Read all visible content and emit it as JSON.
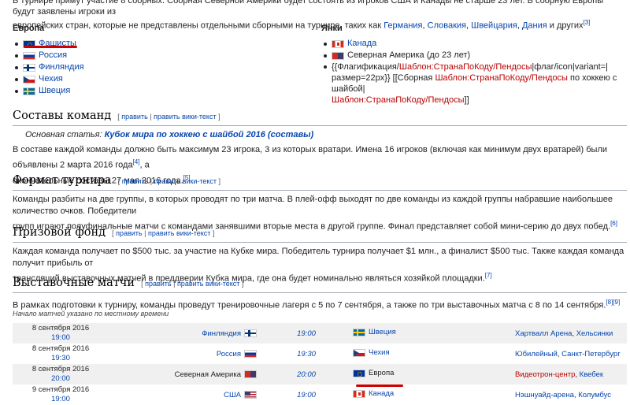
{
  "intro": {
    "line1": "В турнире примут участие 8 сборных. Сборная Северной Америки будет состоять из игроков США и Канады не старше 23 лет. В сборную Европы будут заявлены игроки из",
    "line2_prefix": "европейских стран, которые не представлены отдельными сборными на турнире, таких как ",
    "line2_links": [
      "Германия",
      "Словакия",
      "Швейцария",
      "Дания"
    ],
    "line2_suffix": " и других",
    "ref": "[3]"
  },
  "groups": [
    {
      "title": "Европа",
      "teams": [
        {
          "flag": "eu-flag",
          "label": "Фашисты",
          "link": true
        },
        {
          "flag": "russia-flag",
          "label": "Россия",
          "link": true
        },
        {
          "flag": "finland-flag",
          "label": "Финляндия",
          "link": true
        },
        {
          "flag": "czech-flag",
          "label": "Чехия",
          "link": true
        },
        {
          "flag": "sweden-flag",
          "label": "Швеция",
          "link": true
        }
      ]
    },
    {
      "title": "Янки",
      "teams": [
        {
          "flag": "canada-flag",
          "label": "Канада",
          "link": true
        },
        {
          "flag": "north-america-flag",
          "label": "Северная Америка (до 23 лет)",
          "link": false
        }
      ],
      "template_text": {
        "l1_a": "{{Флагификация/",
        "l1_b": "Шаблон:СтранаПоКоду/Пендосы",
        "l1_c": "|флаг/icon|variant=|",
        "l2_a": "размер=22px}} [[Сборная ",
        "l2_b": "Шаблон:СтранаПоКоду/Пендосы",
        "l2_c": " по хоккею с шайбой|",
        "l3_a": "Шаблон:СтранаПоКоду/Пендосы",
        "l3_b": "]]"
      }
    }
  ],
  "edit_links": {
    "edit": "править",
    "sep": " | ",
    "wiki": "править вики-текст"
  },
  "sections": {
    "rosters": {
      "title": "Составы команд",
      "hatnote_label": "Основная статья: ",
      "hatnote_link": "Кубок мира по хоккею с шайбой 2016 (составы)",
      "text1": "В составе каждой команды должно быть максимум 23 игрока, 3 из которых вратари. Имена 16 игроков (включая как минимум двух вратарей) были объявлены 2 марта 2016 года",
      "ref1": "[4]",
      "text1b": ", а",
      "text2": "окончательные составы 27 мая 2016 года.",
      "ref2": "[5]"
    },
    "format": {
      "title": "Формат турнира",
      "text1": "Команды разбиты на две группы, в которых проводят по три матча. В плей-офф выходят по две команды из каждой группы набравшие наибольшее количество очков. Победители",
      "text2": "групп играют полуфинальные матчи с командами занявшими вторые места в другой группе. Финал представляет собой мини-серию до двух побед.",
      "ref": "[6]"
    },
    "prize": {
      "title": "Призовой фонд",
      "text1": "Каждая команда получает по $500 тыс. за участие на Кубке мира. Победитель турнира получает $1 млн., а финалист $500 тыс. Также каждая команда получит прибыль от",
      "text2": "трансляций выставочных матчей в преддверии Кубка мира, где она будет номинально являться хозяйкой площадки.",
      "ref": "[7]"
    },
    "exhibition": {
      "title": "Выставочные матчи",
      "text": "В рамках подготовки к турниру, команды проведут тренировочные лагеря с 5 по 7 сентября, а также по три выставочных матча с 8 по 14 сентября.",
      "ref": "[8][9]",
      "note": "Начало матчей указано по местному времени"
    }
  },
  "games": [
    {
      "date": "8 сентября 2016",
      "time_local": "19:00",
      "home": "Финляндия",
      "home_flag": "finland-flag",
      "time": "19:00",
      "away": "Швеция",
      "away_flag": "sweden-flag",
      "arena": "Хартвалл Арена",
      "city": "Хельсинки"
    },
    {
      "date": "8 сентября 2016",
      "time_local": "19:30",
      "home": "Россия",
      "home_flag": "russia-flag",
      "time": "19:30",
      "away": "Чехия",
      "away_flag": "czech-flag",
      "arena": "Юбилейный",
      "city": "Санкт-Петербург"
    },
    {
      "date": "8 сентября 2016",
      "time_local": "20:00",
      "home": "Северная Америка",
      "home_flag": "north-america-flag",
      "time": "20:00",
      "away": "Европа",
      "away_flag": "eu-flag",
      "arena": "Видеотрон-центр",
      "city": "Квебек"
    },
    {
      "date": "9 сентября 2016",
      "time_local": "19:00",
      "home": "США",
      "home_flag": "usa-flag",
      "time": "19:00",
      "away": "Канада",
      "away_flag": "canada-flag",
      "arena": "Нэшнуайд-арена",
      "city": "Колумбус"
    }
  ],
  "colors": {
    "link": "#0645ad",
    "redlink": "#ba0000",
    "annotation_underline": "#d00000",
    "row_shade": "#f0f0f0"
  }
}
